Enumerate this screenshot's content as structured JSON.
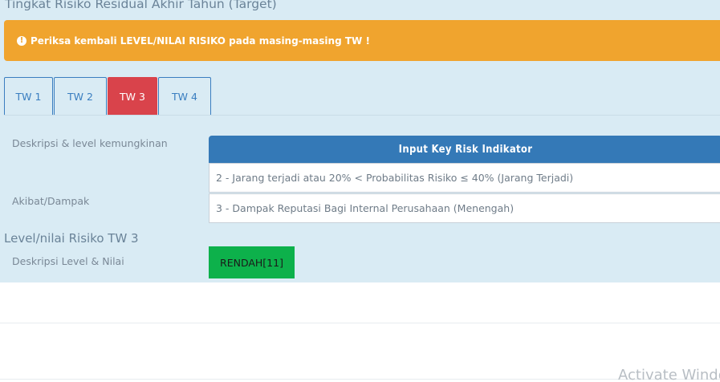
{
  "section": {
    "title": "Tingkat Risiko Residual Akhir Tahun (Target)"
  },
  "alert": {
    "icon": "exclamation-circle-icon",
    "text": "Periksa kembali LEVEL/NILAI RISIKO pada masing-masing TW !",
    "color": "#f0a42e"
  },
  "tabs": [
    {
      "label": "TW 1",
      "active": false
    },
    {
      "label": "TW 2",
      "active": false
    },
    {
      "label": "TW 3",
      "active": true
    },
    {
      "label": "TW 4",
      "active": false
    }
  ],
  "form": {
    "likelihood_label": "Deskripsi & level kemungkinan",
    "impact_label": "Akibat/Dampak",
    "kri_header": "Input Key Risk Indikator",
    "likelihood_value": "2 - Jarang terjadi atau 20% < Probabilitas Risiko ≤ 40% (Jarang Terjadi)",
    "impact_value": "3 - Dampak Reputasi Bagi Internal Perusahaan (Menengah)"
  },
  "level": {
    "title": "Level/nilai Risiko TW 3",
    "desc_label": "Deskripsi Level & Nilai",
    "badge": "RENDAH[11]",
    "badge_color": "#0db14b"
  },
  "watermark": "Activate Windo"
}
